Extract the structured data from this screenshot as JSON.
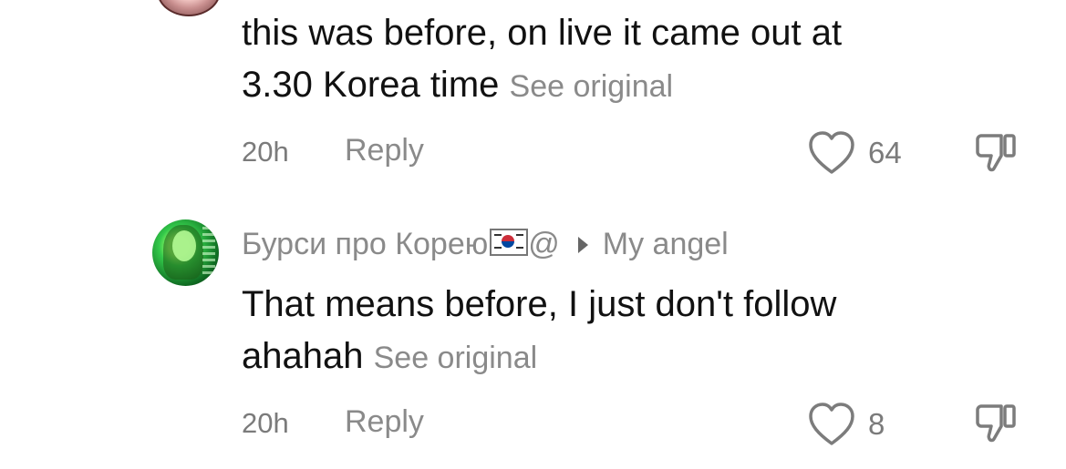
{
  "comments": [
    {
      "text_line1": "this was before, on live it came out at",
      "text_line2": "3.30 Korea time",
      "see_original": "See original",
      "time": "20h",
      "reply_label": "Reply",
      "likes": "64"
    },
    {
      "username": "Бурси про Корею",
      "username_suffix": "@",
      "reply_to": "My angel",
      "text_line1": "That means before, I just don't follow",
      "text_line2": "ahahah",
      "see_original": "See original",
      "time": "20h",
      "reply_label": "Reply",
      "likes": "8"
    }
  ],
  "icons": {
    "like": "heart-outline-icon",
    "dislike": "thumbs-down-outline-icon",
    "reply_arrow": "play-arrow-icon",
    "flag": "south-korea-flag"
  }
}
